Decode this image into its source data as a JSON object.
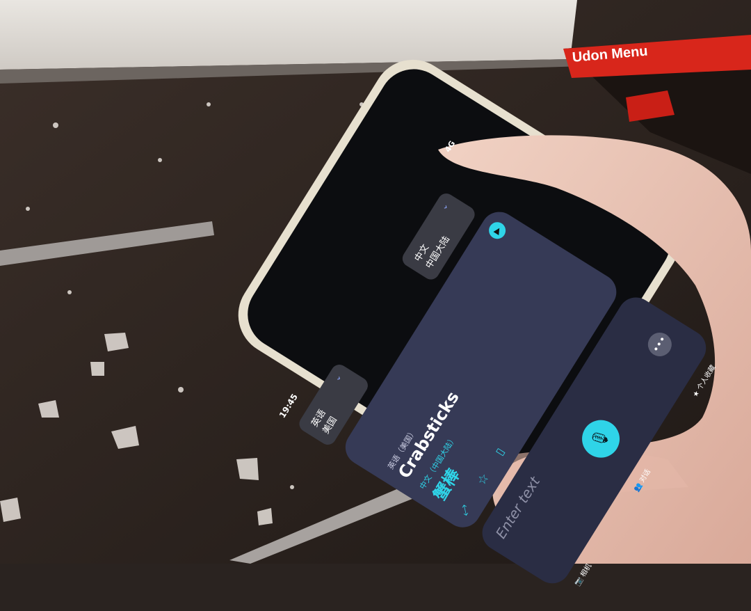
{
  "status_bar": {
    "time": "19:45",
    "network": "4G"
  },
  "language_picker": {
    "source": {
      "label": "英语\n美国"
    },
    "target": {
      "label": "中文\n中国大陆"
    }
  },
  "translation_card": {
    "source_lang": "英语（美国）",
    "source_text": "Crabsticks",
    "target_lang": "中文（中国大陆）",
    "target_text": "蟹棒"
  },
  "input": {
    "placeholder": "Enter text"
  },
  "bottom_tabs": [
    {
      "label": "相机",
      "icon": "camera-icon"
    },
    {
      "label": "对话",
      "icon": "conversation-icon"
    },
    {
      "label": "个人收藏",
      "icon": "star-icon"
    }
  ],
  "background": {
    "sign_text": "Udon Menu"
  },
  "colors": {
    "accent": "#2fd4e8",
    "card_bg": "#3a3e5a",
    "screen_bg": "#111318",
    "sign_red": "#d8261b"
  }
}
